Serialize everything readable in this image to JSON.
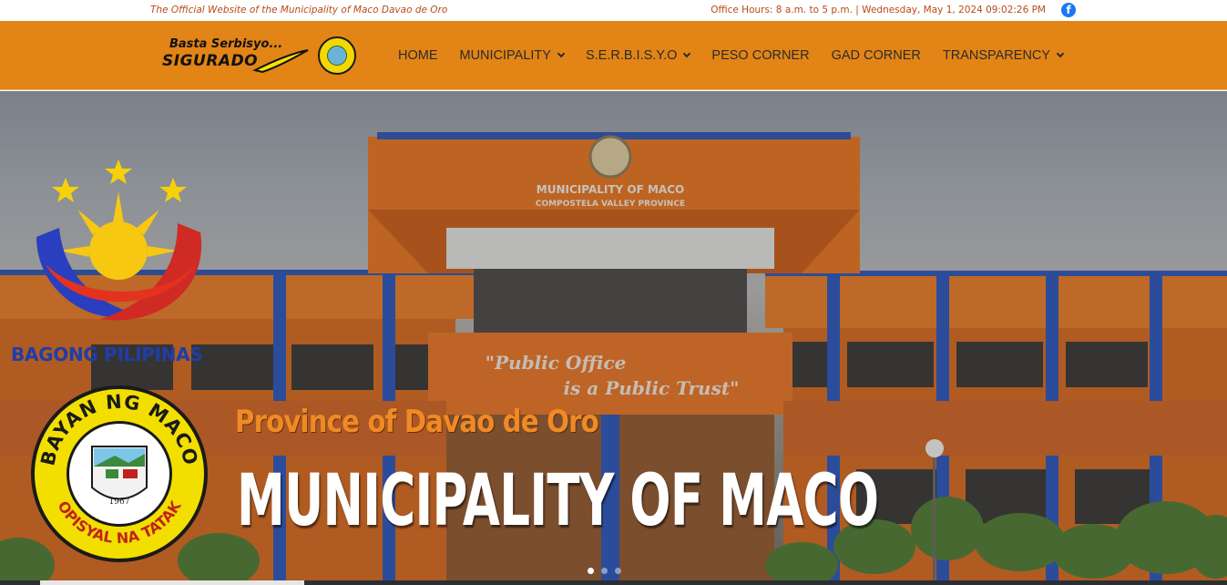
{
  "topbar": {
    "tagline": "The Official Website of the Municipality of Maco Davao de Oro",
    "office_hours": "Office Hours: 8 a.m. to 5 p.m. | Wednesday, May 1, 2024 09:02:26 PM",
    "social_icon": "facebook-icon"
  },
  "brand": {
    "line1": "Basta Serbisyo...",
    "line2": "SIGURADO"
  },
  "nav": {
    "items": [
      {
        "label": "HOME",
        "dropdown": false
      },
      {
        "label": "MUNICIPALITY",
        "dropdown": true
      },
      {
        "label": "S.E.R.B.I.S.Y.O",
        "dropdown": true
      },
      {
        "label": "PESO CORNER",
        "dropdown": false
      },
      {
        "label": "GAD CORNER",
        "dropdown": false
      },
      {
        "label": "TRANSPARENCY",
        "dropdown": true
      }
    ]
  },
  "hero": {
    "logo_text": "BAGONG PILIPINAS",
    "seal_top": "BAYAN NG MACO",
    "seal_bottom": "OPISYAL NA TATAK",
    "seal_year": "1967",
    "building_sign": "MUNICIPALITY OF MACO",
    "building_sign_sub": "COMPOSTELA VALLEY PROVINCE",
    "building_motto_1": "\"Public Office",
    "building_motto_2": "is a Public Trust\"",
    "subtitle": "Province of Davao de Oro",
    "title": "MUNICIPALITY OF MACO",
    "slides": 3,
    "active_slide": 1
  },
  "colors": {
    "nav_bg": "#e28516",
    "accent_text": "#b84a17",
    "subtitle": "#f08a24",
    "facebook": "#1877f2"
  }
}
